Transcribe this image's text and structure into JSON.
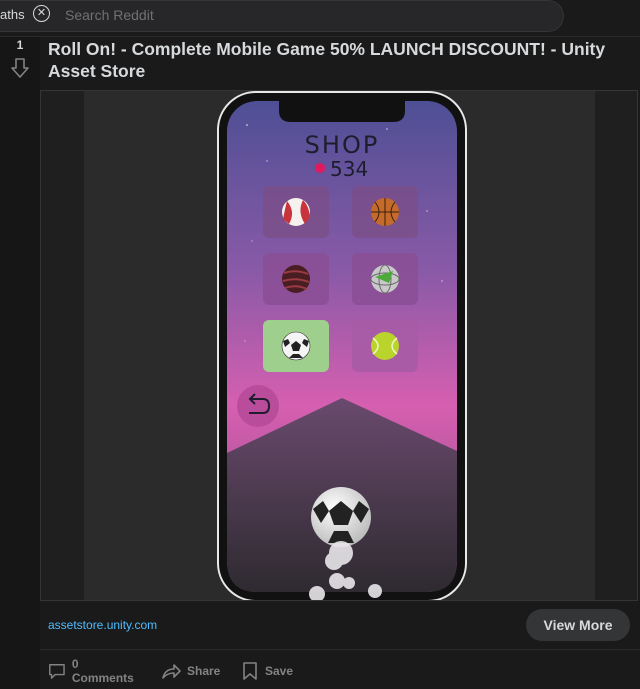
{
  "search": {
    "chip_label": "aths",
    "placeholder": "Search Reddit"
  },
  "post": {
    "vote_count": "1",
    "title": "Roll On! - Complete Mobile Game 50% LAUNCH DISCOUNT! - Unity Asset Store",
    "domain": "assetstore.unity.com",
    "view_more_label": "View More",
    "actions": {
      "comments_label": "0 Comments",
      "share_label": "Share",
      "save_label": "Save"
    }
  },
  "game": {
    "heading": "SHOP",
    "coins": "534",
    "balls": [
      "beach-ball",
      "basketball",
      "striped-ball",
      "world-ball",
      "soccer-ball",
      "tennis-ball"
    ],
    "selected_index": 4
  },
  "colors": {
    "background": "#1a1a1b",
    "link": "#4fbcff",
    "accent_pink": "#e01a5d",
    "selected_tile": "#9fcf8c"
  }
}
